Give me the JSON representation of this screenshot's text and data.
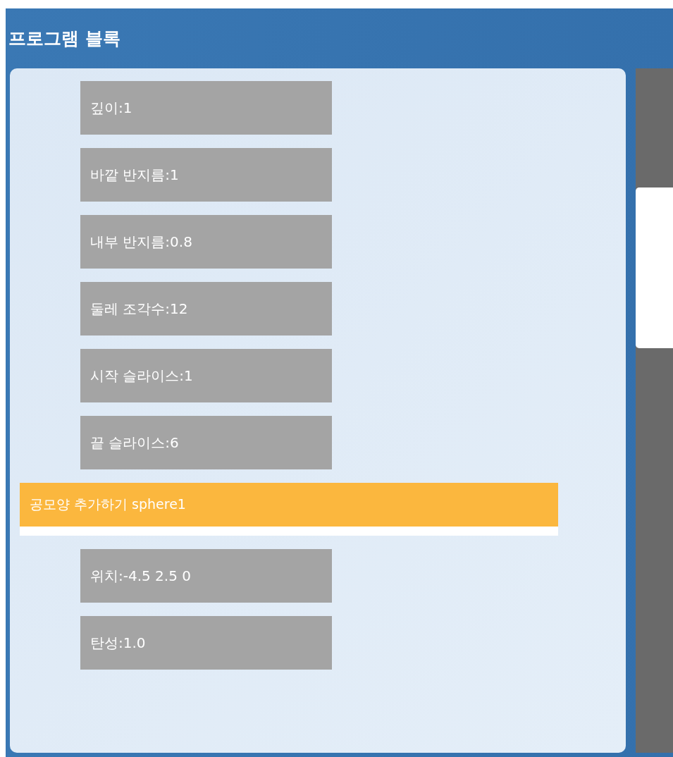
{
  "panel": {
    "title": "프로그램 블록"
  },
  "blocks": [
    {
      "kind": "param",
      "text": "깊이:1"
    },
    {
      "kind": "param",
      "text": "바깥 반지름:1"
    },
    {
      "kind": "param",
      "text": "내부 반지름:0.8"
    },
    {
      "kind": "param",
      "text": "둘레 조각수:12"
    },
    {
      "kind": "param",
      "text": "시작 슬라이스:1"
    },
    {
      "kind": "param",
      "text": "끝 슬라이스:6"
    },
    {
      "kind": "command",
      "text": "공모양 추가하기 sphere1"
    },
    {
      "kind": "param",
      "text": "위치:-4.5  2.5  0"
    },
    {
      "kind": "param",
      "text": "탄성:1.0"
    }
  ]
}
